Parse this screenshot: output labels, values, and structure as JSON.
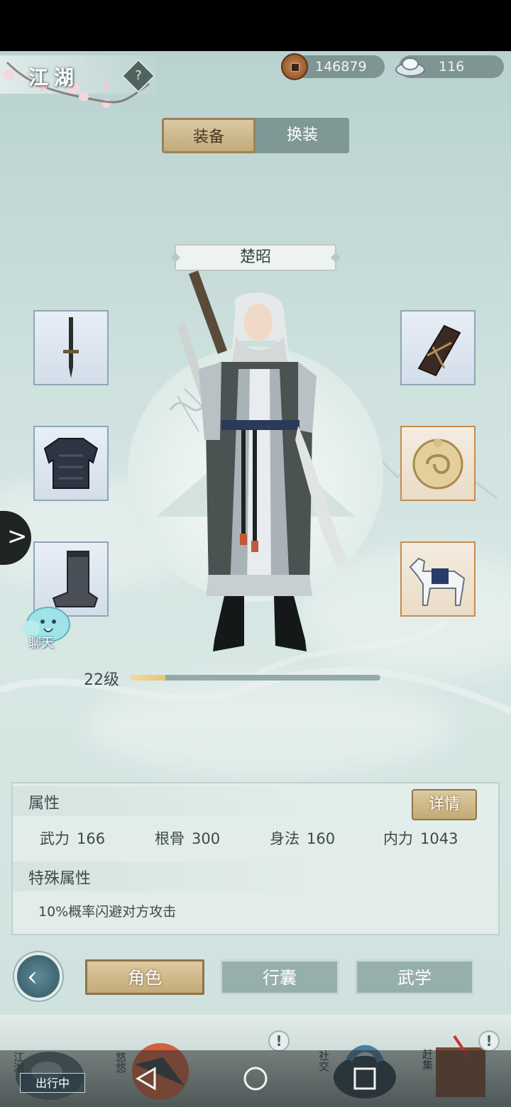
{
  "header": {
    "title": "江湖",
    "hint_icon": "question-scroll-icon",
    "copper": {
      "icon": "copper-coin-icon",
      "value": "146879"
    },
    "silver": {
      "icon": "silver-ingot-icon",
      "value": "116"
    }
  },
  "tabs": [
    {
      "label": "装备",
      "active": true
    },
    {
      "label": "换装",
      "active": false
    }
  ],
  "character": {
    "name": "楚昭",
    "level_label": "22级",
    "level_progress": 0.14
  },
  "equipment": {
    "weapon": "sword-icon",
    "armor": "chest-armor-icon",
    "boots": "boots-icon",
    "bracer": "bracer-icon",
    "accessory": "jade-pendant-icon",
    "mount": "white-horse-icon"
  },
  "chat": {
    "label": "聊天"
  },
  "attributes": {
    "section_title": "属性",
    "details_label": "详情",
    "stats": [
      {
        "name": "武力",
        "value": "166"
      },
      {
        "name": "根骨",
        "value": "300"
      },
      {
        "name": "身法",
        "value": "160"
      },
      {
        "name": "内力",
        "value": "1043"
      }
    ],
    "special_title": "特殊属性",
    "special_text": "10%概率闪避对方攻击"
  },
  "nav": {
    "back_icon": "back-arrow-icon",
    "buttons": [
      {
        "label": "角色",
        "active": true
      },
      {
        "label": "行囊",
        "active": false
      },
      {
        "label": "武学",
        "active": false
      }
    ]
  },
  "dock": {
    "items": [
      {
        "label": "江湖"
      },
      {
        "label": "悠悠"
      },
      {
        "label": "社交"
      },
      {
        "label": "赶集"
      }
    ],
    "status_label": "出行中",
    "alert_symbol": "!"
  },
  "colors": {
    "accent_gold": "#c4aa79",
    "panel_bg": "#cfe2df",
    "slot_blue": "#8ea6b6",
    "slot_orange": "#c98b4e"
  }
}
